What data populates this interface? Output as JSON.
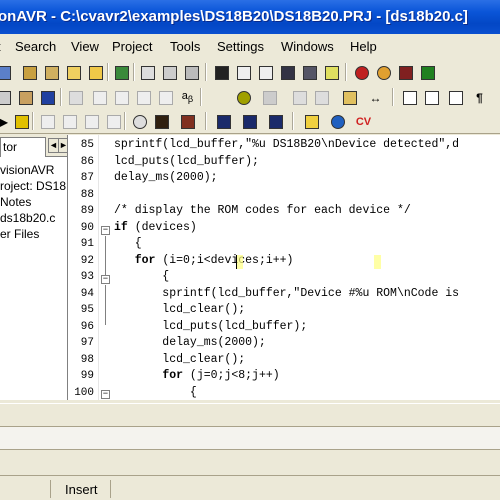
{
  "window": {
    "title": "onAVR - C:\\cvavr2\\examples\\DS18B20\\DS18B20.PRJ - [ds18b20.c]"
  },
  "menu": {
    "items": [
      "Search",
      "View",
      "Project",
      "Tools",
      "Settings",
      "Windows",
      "Help"
    ]
  },
  "panel": {
    "tab_label": "tor",
    "tree": [
      "visionAVR",
      "roject: DS18",
      "Notes",
      "ds18b20.c",
      "er Files"
    ]
  },
  "editor": {
    "lines": [
      {
        "num": "85",
        "text": "sprintf(lcd_buffer,\"%u DS18B20\\nDevice detected\",d"
      },
      {
        "num": "86",
        "text": "lcd_puts(lcd_buffer);"
      },
      {
        "num": "87",
        "text": "delay_ms(2000);"
      },
      {
        "num": "88",
        "text": ""
      },
      {
        "num": "89",
        "text": "/* display the ROM codes for each device */"
      },
      {
        "num": "90",
        "text": "if (devices)"
      },
      {
        "num": "91",
        "text": "   {"
      },
      {
        "num": "92",
        "text": "   for (i=0;i<devices;i++)"
      },
      {
        "num": "93",
        "text": "       {"
      },
      {
        "num": "94",
        "text": "       sprintf(lcd_buffer,\"Device #%u ROM\\nCode is"
      },
      {
        "num": "95",
        "text": "       lcd_clear();"
      },
      {
        "num": "96",
        "text": "       lcd_puts(lcd_buffer);"
      },
      {
        "num": "97",
        "text": "       delay_ms(2000);"
      },
      {
        "num": "98",
        "text": "       lcd_clear();"
      },
      {
        "num": "99",
        "text": "       for (j=0;j<8;j++)"
      },
      {
        "num": "100",
        "text": "           {"
      }
    ]
  },
  "status": {
    "mode": "Insert"
  },
  "colors": {
    "titlebar": "#0a55d8",
    "bracket_highlight": "#ffff80",
    "chrome": "#ece9d8"
  }
}
